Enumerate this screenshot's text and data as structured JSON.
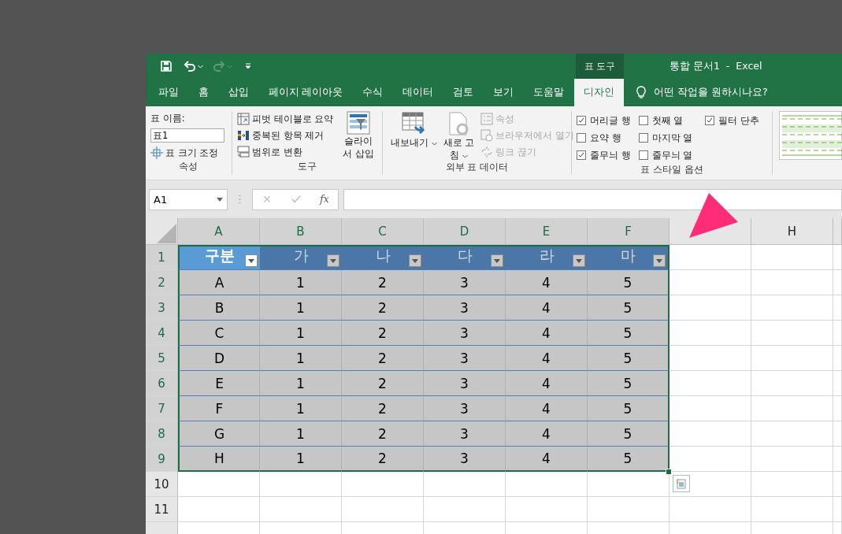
{
  "title_bar": {
    "context_tab": "표 도구",
    "title": "통합 문서1  -  Excel"
  },
  "tabs": [
    {
      "label": "파일",
      "selected": false
    },
    {
      "label": "홈",
      "selected": false
    },
    {
      "label": "삽입",
      "selected": false
    },
    {
      "label": "페이지 레이아웃",
      "selected": false
    },
    {
      "label": "수식",
      "selected": false
    },
    {
      "label": "데이터",
      "selected": false
    },
    {
      "label": "검토",
      "selected": false
    },
    {
      "label": "보기",
      "selected": false
    },
    {
      "label": "도움말",
      "selected": false
    },
    {
      "label": "디자인",
      "selected": true
    }
  ],
  "tell_me": {
    "placeholder": "어떤 작업을 원하시나요?"
  },
  "ribbon": {
    "groups": [
      {
        "kind": "properties",
        "label": "속성",
        "name_label": "표 이름:",
        "name_value": "표1",
        "resize_button": "표 크기 조정"
      },
      {
        "kind": "tools",
        "label": "도구",
        "items": [
          {
            "label": "피벗 테이블로 요약"
          },
          {
            "label": "중복된 항목 제거"
          },
          {
            "label": "범위로 변환"
          }
        ],
        "big_button": {
          "lines": [
            "슬라이",
            "서 삽입"
          ]
        }
      },
      {
        "kind": "external",
        "label": "외부 표 데이터",
        "big_buttons": [
          {
            "lines": [
              "내보내기"
            ]
          },
          {
            "lines": [
              "새로 고",
              "침"
            ]
          }
        ],
        "items": [
          {
            "label": "속성",
            "disabled": true
          },
          {
            "label": "브라우저에서 열기",
            "disabled": true
          },
          {
            "label": "링크 끊기",
            "disabled": true
          }
        ]
      },
      {
        "kind": "options",
        "label": "표 스타일 옵션",
        "options": [
          {
            "label": "머리글 행",
            "checked": true
          },
          {
            "label": "요약 행",
            "checked": false
          },
          {
            "label": "줄무늬 행",
            "checked": true
          },
          {
            "label": "첫째 열",
            "checked": false
          },
          {
            "label": "마지막 열",
            "checked": false
          },
          {
            "label": "줄무늬 열",
            "checked": false
          },
          {
            "label": "필터 단추",
            "checked": true
          }
        ]
      },
      {
        "kind": "gallery"
      }
    ]
  },
  "formula_bar": {
    "name_box": "A1",
    "function_label": "fx"
  },
  "sheet": {
    "columns": [
      {
        "label": "A",
        "selected": true
      },
      {
        "label": "B",
        "selected": true
      },
      {
        "label": "C",
        "selected": true
      },
      {
        "label": "D",
        "selected": true
      },
      {
        "label": "E",
        "selected": true
      },
      {
        "label": "F",
        "selected": true
      },
      {
        "selected": false
      },
      {
        "label": "H",
        "selected": false
      }
    ],
    "rows": [
      {
        "number": "1",
        "selected": true,
        "cells": [
          {
            "text": "구분",
            "selected": true
          },
          {
            "text": "가",
            "selected": false
          },
          {
            "text": "나",
            "selected": false
          },
          {
            "text": "다",
            "selected": false
          },
          {
            "text": "라",
            "selected": false
          },
          {
            "text": "마",
            "selected": false
          }
        ]
      },
      {
        "number": "2",
        "selected": true,
        "cells": [
          "A",
          "1",
          "2",
          "3",
          "4",
          "5"
        ]
      },
      {
        "number": "3",
        "selected": true,
        "cells": [
          "B",
          "1",
          "2",
          "3",
          "4",
          "5"
        ]
      },
      {
        "number": "4",
        "selected": true,
        "cells": [
          "C",
          "1",
          "2",
          "3",
          "4",
          "5"
        ]
      },
      {
        "number": "5",
        "selected": true,
        "cells": [
          "D",
          "1",
          "2",
          "3",
          "4",
          "5"
        ]
      },
      {
        "number": "6",
        "selected": true,
        "cells": [
          "E",
          "1",
          "2",
          "3",
          "4",
          "5"
        ]
      },
      {
        "number": "7",
        "selected": true,
        "cells": [
          "F",
          "1",
          "2",
          "3",
          "4",
          "5"
        ]
      },
      {
        "number": "8",
        "selected": true,
        "cells": [
          "G",
          "1",
          "2",
          "3",
          "4",
          "5"
        ]
      },
      {
        "number": "9",
        "selected": true,
        "cells": [
          "H",
          "1",
          "2",
          "3",
          "4",
          "5"
        ]
      },
      {
        "number": "10",
        "selected": false
      },
      {
        "number": "11",
        "selected": false
      }
    ]
  },
  "annotation": {
    "kind": "arrow"
  }
}
